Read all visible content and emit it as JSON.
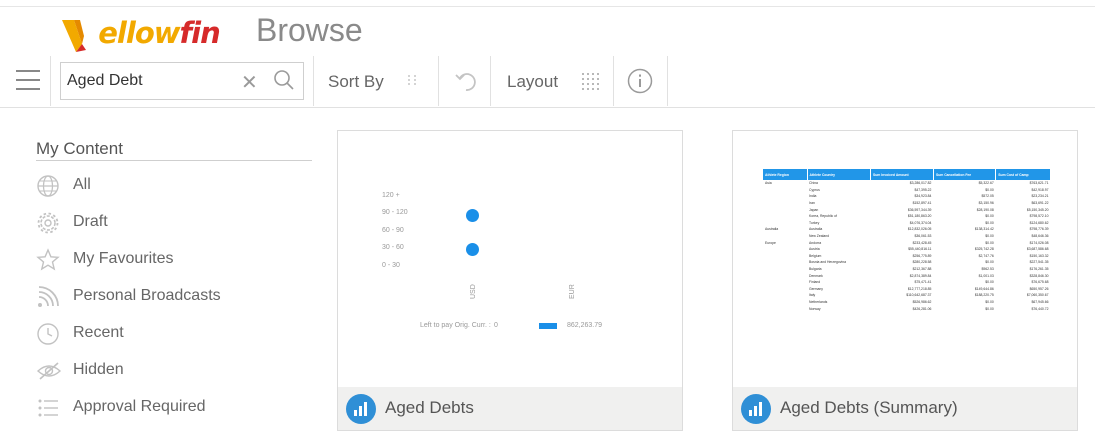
{
  "header": {
    "logo_text_y": "Y",
    "logo_text_ellow": "ellow",
    "logo_text_fin": "fin",
    "page_title": "Browse"
  },
  "toolbar": {
    "search_value": "Aged Debt",
    "sort_label": "Sort By",
    "layout_label": "Layout"
  },
  "sidebar": {
    "heading": "My Content",
    "items": [
      {
        "label": "All",
        "icon": "globe-icon"
      },
      {
        "label": "Draft",
        "icon": "gear-icon"
      },
      {
        "label": "My Favourites",
        "icon": "star-icon"
      },
      {
        "label": "Personal Broadcasts",
        "icon": "broadcast-icon"
      },
      {
        "label": "Recent",
        "icon": "clock-icon"
      },
      {
        "label": "Hidden",
        "icon": "eye-slash-icon"
      },
      {
        "label": "Approval Required",
        "icon": "checklist-icon"
      }
    ]
  },
  "cards": [
    {
      "name": "Aged Debts",
      "preview": {
        "y_labels": [
          "120 +",
          "90 - 120",
          "60 - 90",
          "30 - 60",
          "0 - 30"
        ],
        "x_labels": [
          "USD",
          "EUR"
        ],
        "legend_left": "Left to pay Orig. Curr. :",
        "legend_min": "0",
        "legend_max": "862,263.79"
      }
    },
    {
      "name": "Aged Debts (Summary)",
      "preview": {
        "headers": [
          "Athlete Region",
          "Athlete Country",
          "Sum Invoiced Amount",
          "Sum Cancellation Fee",
          "Sum Cost of Camp"
        ],
        "rows": [
          [
            "Asia",
            "China",
            "$3,286,017.82",
            "$5,322.67",
            "$763,621.71"
          ],
          [
            "",
            "Cyprus",
            "$47,395.22",
            "$0.00",
            "$42,918.97"
          ],
          [
            "",
            "India",
            "$34,923.84",
            "$572.05",
            "$23,234.21"
          ],
          [
            "",
            "Iran",
            "$152,897.41",
            "$3,150.96",
            "$63,691.22"
          ],
          [
            "",
            "Japan",
            "$36,597,344.39",
            "$28,190.08",
            "$5,150,345.20"
          ],
          [
            "",
            "Korea, Republic of",
            "$51,180,863.20",
            "$0.00",
            "$798,572.10"
          ],
          [
            "",
            "Turkey",
            "$4,076,374.04",
            "$0.00",
            "$124,680.62"
          ],
          [
            "Australia",
            "Australia",
            "$12,832,026.05",
            "$138,314.42",
            "$798,776.39"
          ],
          [
            "",
            "New Zealand",
            "$36,061.53",
            "$0.00",
            "$48,646.36"
          ],
          [
            "Europe",
            "Andorra",
            "$233,428.45",
            "$0.00",
            "$174,026.08"
          ],
          [
            "",
            "Austria",
            "$55,440,816.11",
            "$325,742.28",
            "$3,687,586.68"
          ],
          [
            "",
            "Belgium",
            "$256,775.89",
            "$2,747.76",
            "$150,163.32"
          ],
          [
            "",
            "Bosnia and Herzegovina",
            "$280,228.58",
            "$0.00",
            "$227,541.35"
          ],
          [
            "",
            "Bulgaria",
            "$212,367.88",
            "$962.53",
            "$176,261.35"
          ],
          [
            "",
            "Denmark",
            "$2,874,389.84",
            "$1,001.03",
            "$328,846.30"
          ],
          [
            "",
            "Finland",
            "$75,471.41",
            "$0.00",
            "$76,675.68"
          ],
          [
            "",
            "Germany",
            "$12,777,218.85",
            "$149,644.86",
            "$650,957.26"
          ],
          [
            "",
            "Italy",
            "$110,642,687.37",
            "$188,220.75",
            "$7,060,350.67"
          ],
          [
            "",
            "Netherlands",
            "$526,986.62",
            "$0.00",
            "$67,945.66"
          ],
          [
            "",
            "Norway",
            "$426,281.06",
            "$0.00",
            "$76,440.72"
          ]
        ]
      }
    }
  ],
  "colors": {
    "accent": "#2f8fd6",
    "logo_yellow": "#f2a900",
    "logo_red": "#d62a2a",
    "chart_dot": "#1a8fe8"
  }
}
